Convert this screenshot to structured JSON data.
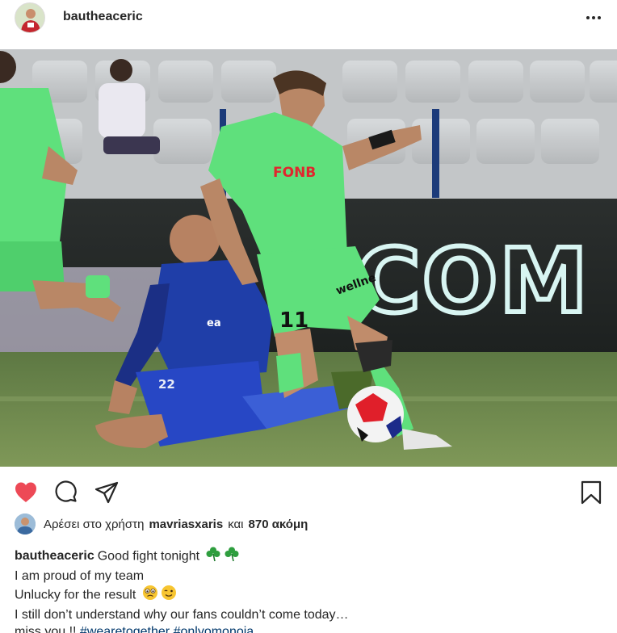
{
  "header": {
    "username": "bautheaceric",
    "avatar_icon": "profile-avatar",
    "more_icon": "more-options-icon"
  },
  "photo": {
    "stadium_sign": "COM",
    "sponsor_text": "FONB",
    "sponsor_shorts": "wellne",
    "player_number": "11",
    "opponent_number": "22",
    "opponent_sponsor": "ea",
    "colors": {
      "omonoia_kit": "#5fe07c",
      "opponent_kit": "#1f3ea8",
      "pitch": "#6f8a4f"
    }
  },
  "actions": {
    "like_icon": "heart-filled-icon",
    "comment_icon": "comment-icon",
    "share_icon": "send-icon",
    "save_icon": "bookmark-icon",
    "like_color": "#ed4956"
  },
  "likes": {
    "prefix": "Αρέσει στο χρήστη",
    "liker": "mavriasxaris",
    "joiner": "και",
    "others": "870 ακόμη"
  },
  "caption": {
    "user": "bautheaceric",
    "line1": "Good fight tonight",
    "line2": "I am proud of my team",
    "line3": "Unlucky for the result",
    "line4": "I still don’t understand why our fans couldn’t come today…",
    "line5_text": "miss you !!",
    "hashtag1": "#wearetogether",
    "hashtag2": "#onlyomonoia"
  }
}
